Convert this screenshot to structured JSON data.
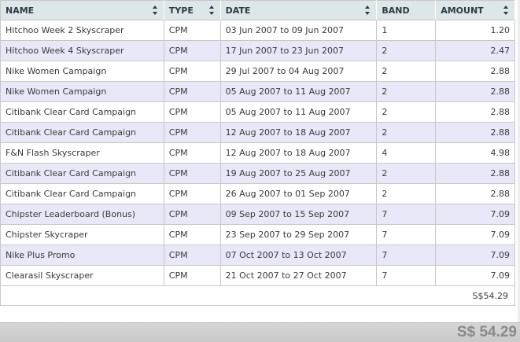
{
  "columns": [
    {
      "label": "NAME"
    },
    {
      "label": "TYPE"
    },
    {
      "label": "DATE"
    },
    {
      "label": "BAND"
    },
    {
      "label": "AMOUNT"
    }
  ],
  "rows": [
    {
      "name": "Hitchoo Week 2 Skyscraper",
      "type": "CPM",
      "date": "03 Jun 2007 to 09 Jun 2007",
      "band": "1",
      "amount": "1.20"
    },
    {
      "name": "Hitchoo Week 4 Skyscraper",
      "type": "CPM",
      "date": "17 Jun 2007 to 23 Jun 2007",
      "band": "2",
      "amount": "2.47"
    },
    {
      "name": "Nike Women Campaign",
      "type": "CPM",
      "date": "29 Jul 2007 to 04 Aug 2007",
      "band": "2",
      "amount": "2.88"
    },
    {
      "name": "Nike Women Campaign",
      "type": "CPM",
      "date": "05 Aug 2007 to 11 Aug 2007",
      "band": "2",
      "amount": "2.88"
    },
    {
      "name": "Citibank Clear Card Campaign",
      "type": "CPM",
      "date": "05 Aug 2007 to 11 Aug 2007",
      "band": "2",
      "amount": "2.88"
    },
    {
      "name": "Citibank Clear Card Campaign",
      "type": "CPM",
      "date": "12 Aug 2007 to 18 Aug 2007",
      "band": "2",
      "amount": "2.88"
    },
    {
      "name": "F&N Flash Skyscraper",
      "type": "CPM",
      "date": "12 Aug 2007 to 18 Aug 2007",
      "band": "4",
      "amount": "4.98"
    },
    {
      "name": "Citibank Clear Card Campaign",
      "type": "CPM",
      "date": "19 Aug 2007 to 25 Aug 2007",
      "band": "2",
      "amount": "2.88"
    },
    {
      "name": "Citibank Clear Card Campaign",
      "type": "CPM",
      "date": "26 Aug 2007 to 01 Sep 2007",
      "band": "2",
      "amount": "2.88"
    },
    {
      "name": "Chipster Leaderboard (Bonus)",
      "type": "CPM",
      "date": "09 Sep 2007 to 15 Sep 2007",
      "band": "7",
      "amount": "7.09"
    },
    {
      "name": "Chipster Skycraper",
      "type": "CPM",
      "date": "23 Sep 2007 to 29 Sep 2007",
      "band": "7",
      "amount": "7.09"
    },
    {
      "name": "Nike Plus Promo",
      "type": "CPM",
      "date": "07 Oct 2007 to 13 Oct 2007",
      "band": "7",
      "amount": "7.09"
    },
    {
      "name": "Clearasil Skyscraper",
      "type": "CPM",
      "date": "21 Oct 2007 to 27 Oct 2007",
      "band": "7",
      "amount": "7.09"
    }
  ],
  "subtotal": "S$54.29",
  "grand_total": "S$ 54.29",
  "colors": {
    "header_bg": "#dde7ea",
    "alt_row_bg": "#e8e8f8",
    "total_bar_bg": "#cccccc"
  },
  "icons": {
    "sort": "sort-arrows-icon"
  }
}
